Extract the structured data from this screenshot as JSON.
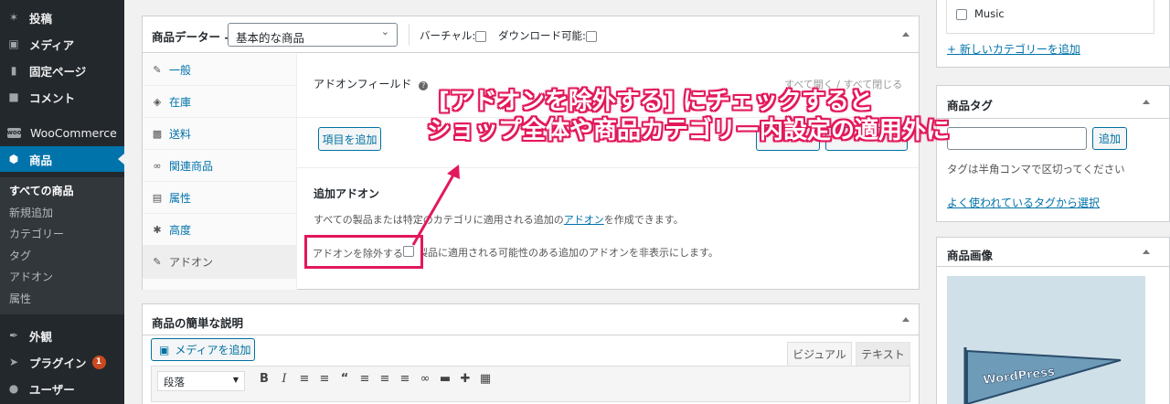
{
  "sidebar": {
    "items": [
      {
        "label": "投稿",
        "icon": "pin-icon"
      },
      {
        "label": "メディア",
        "icon": "media-icon"
      },
      {
        "label": "固定ページ",
        "icon": "page-icon"
      },
      {
        "label": "コメント",
        "icon": "comment-icon"
      },
      {
        "label": "WooCommerce",
        "icon": "woo-icon"
      },
      {
        "label": "商品",
        "icon": "product-icon"
      },
      {
        "label": "外観",
        "icon": "brush-icon"
      },
      {
        "label": "プラグイン",
        "icon": "plugin-icon",
        "badge": "1"
      },
      {
        "label": "ユーザー",
        "icon": "user-icon"
      }
    ],
    "submenu": [
      "すべての商品",
      "新規追加",
      "カテゴリー",
      "タグ",
      "アドオン",
      "属性"
    ]
  },
  "product_data": {
    "title": "商品データー —",
    "type_select": "基本的な商品",
    "virtual_label": "バーチャル:",
    "download_label": "ダウンロード可能:",
    "tabs": [
      {
        "label": "一般",
        "icon": "wrench-icon"
      },
      {
        "label": "在庫",
        "icon": "tag-icon"
      },
      {
        "label": "送料",
        "icon": "truck-icon"
      },
      {
        "label": "関連商品",
        "icon": "link-icon"
      },
      {
        "label": "属性",
        "icon": "list-icon"
      },
      {
        "label": "高度",
        "icon": "gear-icon"
      },
      {
        "label": "アドオン",
        "icon": "wrench-icon"
      }
    ],
    "addon_field_title": "アドオンフィールド",
    "expand_collapse": "すべて開く / すべて閉じる",
    "add_item_button": "項目を追加",
    "additional_addons_title": "追加アドオン",
    "description_prefix": "すべての製品または特定の",
    "description_hidden": "カテゴリに適用される追加の",
    "description_link": "アドオン",
    "description_suffix": "を作成できます。",
    "exclude_label": "アドオンを除外する",
    "exclude_desc": "この製品に適用される可能性のある追加のアドオンを非表示にします。"
  },
  "short_description": {
    "title": "商品の簡単な説明",
    "add_media": "メディアを追加",
    "visual_tab": "ビジュアル",
    "text_tab": "テキスト",
    "format_select": "段落"
  },
  "right": {
    "category_item": "Music",
    "add_category_link": "+ 新しいカテゴリーを追加",
    "tags_title": "商品タグ",
    "tags_add_button": "追加",
    "tags_hint": "タグは半角コンマで区切ってください",
    "tags_popular_link": "よく使われているタグから選択",
    "image_title": "商品画像",
    "pennant_text": "WordPress"
  },
  "callout": {
    "line1": "[アドオンを除外する] にチェックすると",
    "line2": "ショップ全体や商品カテゴリー内設定の適用外に",
    "color": "#e2185a"
  }
}
